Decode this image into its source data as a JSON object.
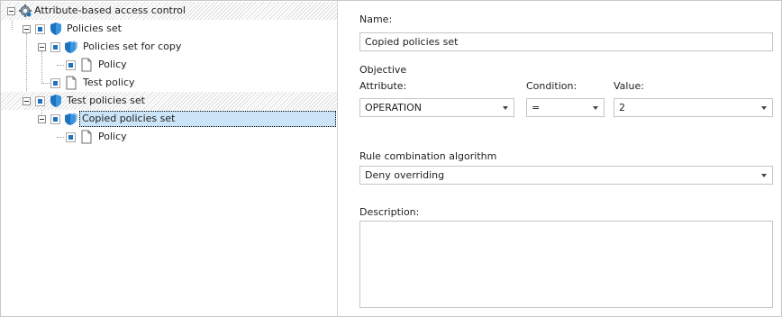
{
  "tree": {
    "root": {
      "label": "Attribute-based access control",
      "icon": "gear-icon"
    },
    "items": [
      {
        "label": "Policies set",
        "icon": "shield-icon"
      },
      {
        "label": "Policies set for copy",
        "icon": "shield-stack-icon"
      },
      {
        "label": "Policy",
        "icon": "document-icon"
      },
      {
        "label": "Test policy",
        "icon": "document-icon"
      },
      {
        "label": "Test policies set",
        "icon": "shield-icon"
      },
      {
        "label": "Copied policies set",
        "icon": "shield-stack-icon"
      },
      {
        "label": "Policy",
        "icon": "document-icon"
      }
    ]
  },
  "form": {
    "name_label": "Name:",
    "name_value": "Copied policies set",
    "objective_label": "Objective",
    "attribute_label": "Attribute:",
    "attribute_value": "OPERATION",
    "condition_label": "Condition:",
    "condition_value": "=",
    "value_label": "Value:",
    "value_value": "2",
    "algorithm_label": "Rule combination algorithm",
    "algorithm_value": "Deny overriding",
    "description_label": "Description:",
    "description_value": ""
  },
  "colors": {
    "accent": "#1e73be",
    "selection": "#cce4f7",
    "border": "#c6c6c6"
  }
}
